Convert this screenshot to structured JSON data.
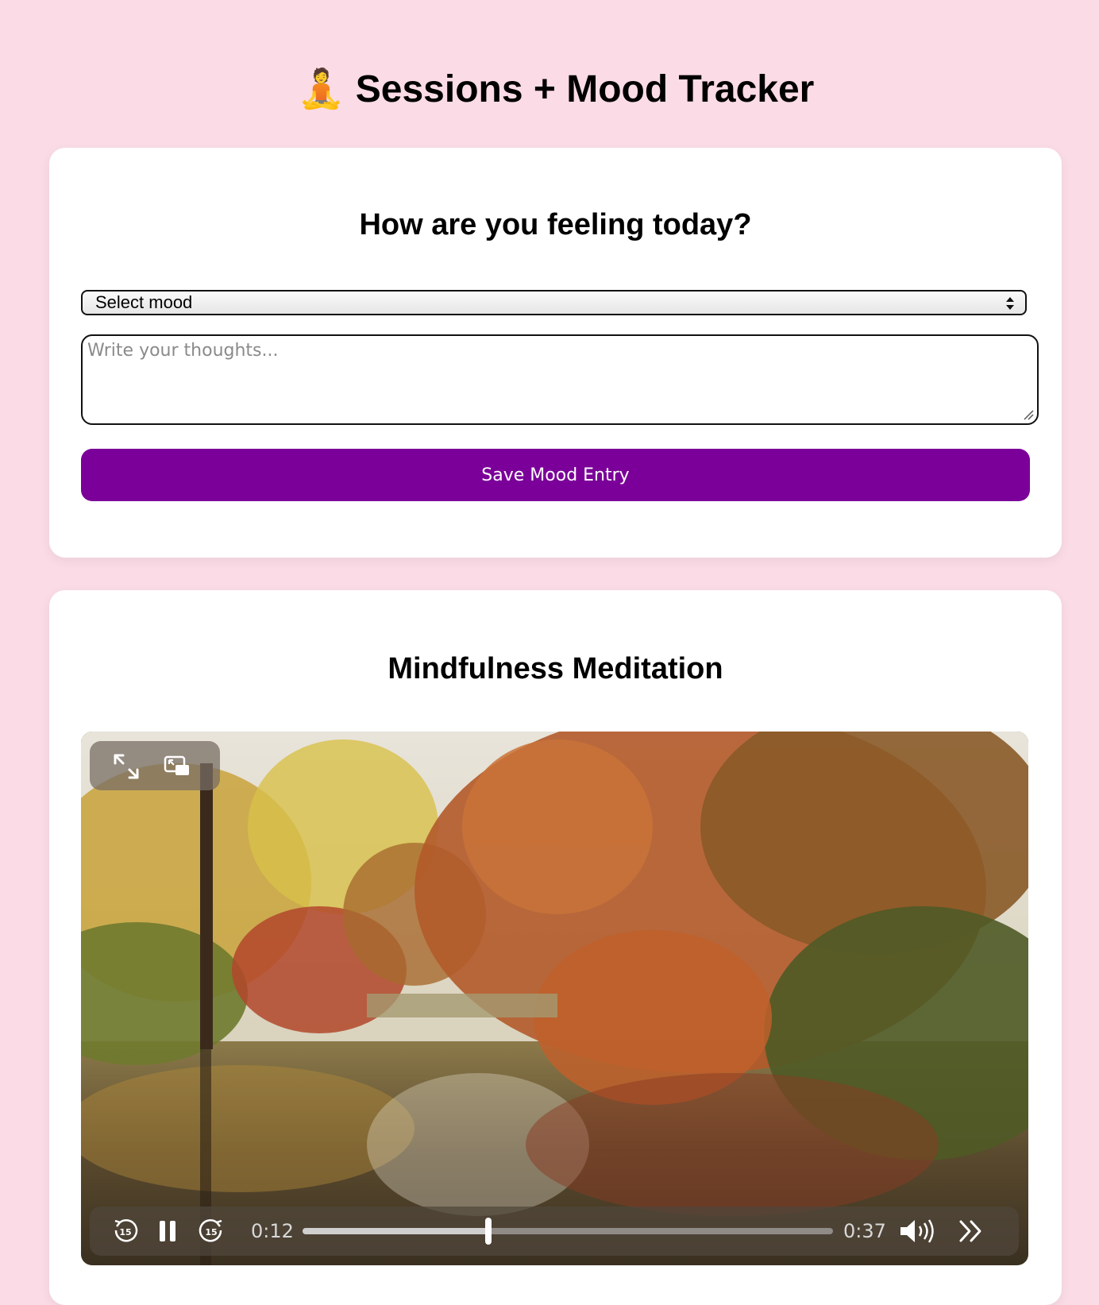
{
  "header": {
    "emoji": "🧘",
    "title": "Sessions + Mood Tracker"
  },
  "mood": {
    "heading": "How are you feeling today?",
    "select_value": "Select mood",
    "textarea_placeholder": "Write your thoughts...",
    "save_label": "Save Mood Entry",
    "accent": "#7b0099"
  },
  "video": {
    "heading": "Mindfulness Meditation",
    "current_time": "0:12",
    "duration": "0:37",
    "progress": 0.35,
    "icons": [
      "fullscreen-icon",
      "picture-in-picture-icon",
      "skip-back-15-icon",
      "pause-icon",
      "skip-forward-15-icon",
      "volume-icon",
      "playback-speed-icon"
    ]
  },
  "colors": {
    "background": "#fadbe6",
    "card": "#ffffff"
  }
}
